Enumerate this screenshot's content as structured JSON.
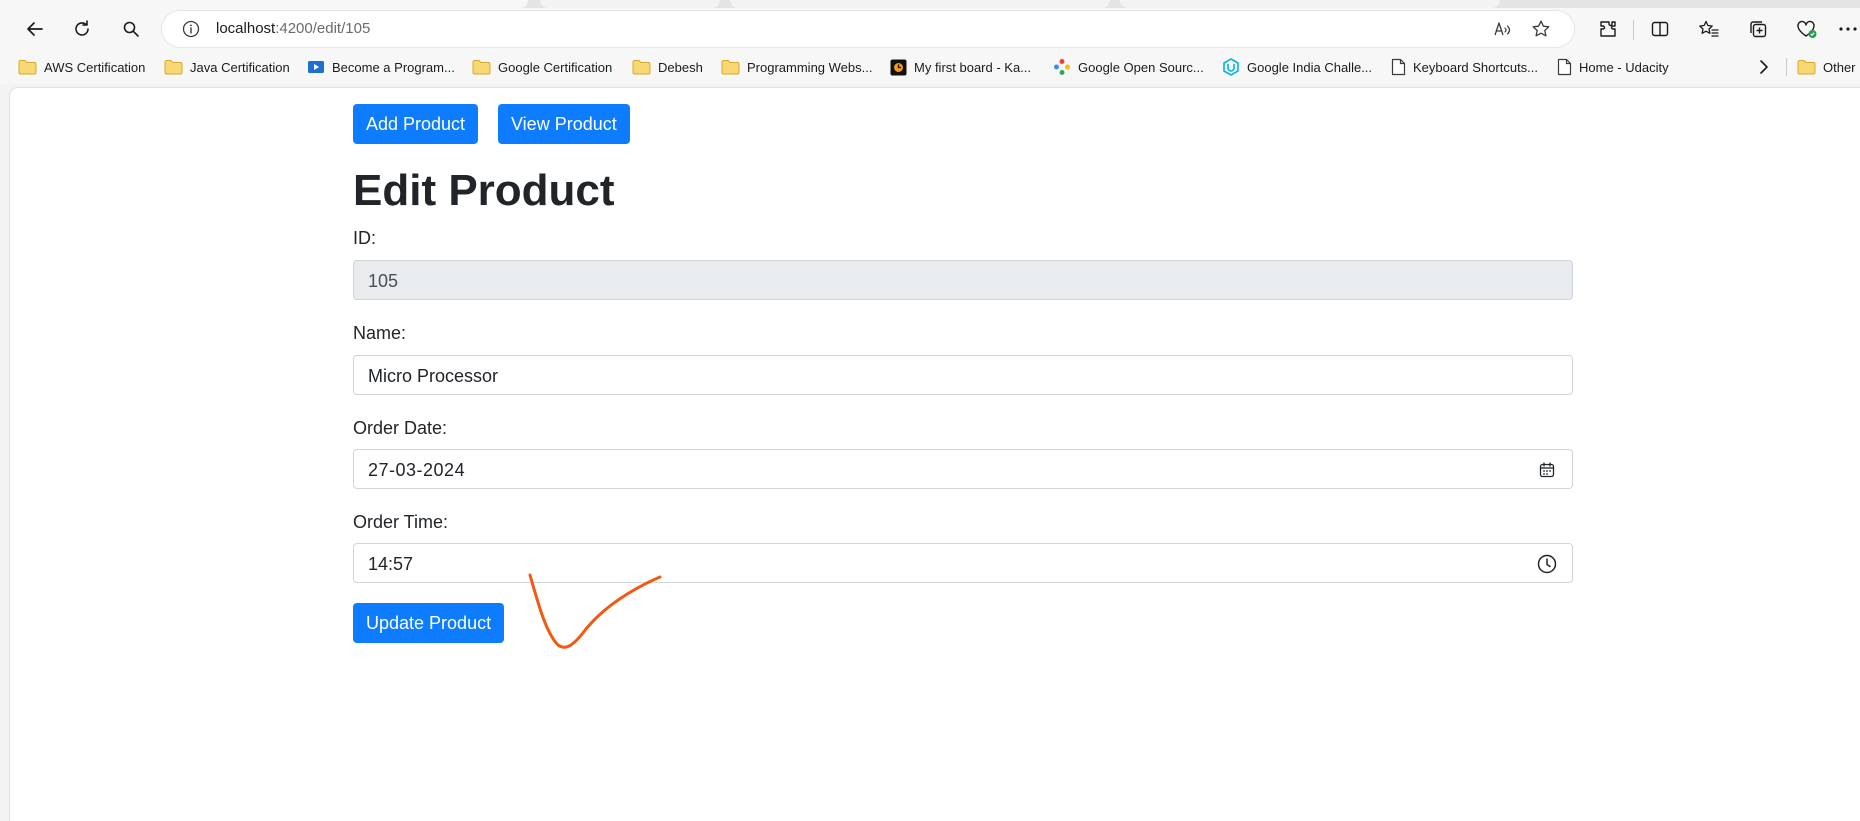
{
  "browser": {
    "url_host": "localhost",
    "url_path": ":4200/edit/105",
    "toolbar_icons": [
      "back-arrow-icon",
      "refresh-icon",
      "search-icon",
      "info-icon",
      "read-aloud-icon",
      "favorite-star-icon",
      "extensions-icon",
      "split-screen-icon",
      "favorites-icon",
      "collections-icon",
      "browser-essentials-icon",
      "more-icon"
    ]
  },
  "bookmarks": [
    {
      "label": "AWS Certification",
      "icon": "folder-icon"
    },
    {
      "label": "Java Certification",
      "icon": "folder-icon"
    },
    {
      "label": "Become a Program...",
      "icon": "video-icon"
    },
    {
      "label": "Google Certification",
      "icon": "folder-icon"
    },
    {
      "label": "Debesh",
      "icon": "folder-icon"
    },
    {
      "label": "Programming Webs...",
      "icon": "folder-icon"
    },
    {
      "label": "My first board - Ka...",
      "icon": "kanban-icon"
    },
    {
      "label": "Google Open Sourc...",
      "icon": "google-open-source-icon"
    },
    {
      "label": "Google India Challe...",
      "icon": "udacity-icon"
    },
    {
      "label": "Keyboard Shortcuts...",
      "icon": "page-icon"
    },
    {
      "label": "Home - Udacity",
      "icon": "page-icon"
    },
    {
      "label": "Other",
      "icon": "folder-icon"
    }
  ],
  "nav": {
    "add_label": "Add Product",
    "view_label": "View Product"
  },
  "form": {
    "title": "Edit Product",
    "id_label": "ID:",
    "id_value": "105",
    "name_label": "Name:",
    "name_value": "Micro Processor",
    "date_label": "Order Date:",
    "date_value": "27-03-2024",
    "time_label": "Order Time:",
    "time_value": "14:57",
    "submit_label": "Update Product"
  },
  "colors": {
    "primary": "#0d7cff",
    "annotation": "#f05a12"
  }
}
